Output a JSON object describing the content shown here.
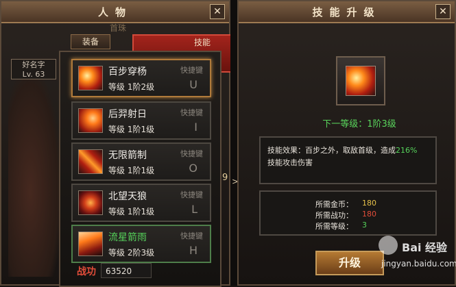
{
  "left_panel": {
    "title": "人物",
    "close_label": "✕",
    "background_label": "首珠",
    "tabs": [
      "装备",
      "技能"
    ],
    "character": {
      "name": "好名字",
      "level": "Lv. 63"
    },
    "skills": [
      {
        "name": "百步穿杨",
        "level_label": "等级",
        "level": "1阶2级",
        "hotkey_label": "快捷键",
        "key": "U",
        "icon": "arrow-burst-icon"
      },
      {
        "name": "后羿射日",
        "level_label": "等级",
        "level": "1阶1级",
        "hotkey_label": "快捷键",
        "key": "I",
        "icon": "sun-arrow-icon"
      },
      {
        "name": "无限箭制",
        "level_label": "等级",
        "level": "1阶1级",
        "hotkey_label": "快捷键",
        "key": "O",
        "icon": "arrow-cross-icon"
      },
      {
        "name": "北望天狼",
        "level_label": "等级",
        "level": "1阶1级",
        "hotkey_label": "快捷键",
        "key": "L",
        "icon": "wolf-spiral-icon"
      },
      {
        "name": "流星箭雨",
        "level_label": "等级",
        "level": "2阶3级",
        "hotkey_label": "快捷键",
        "key": "H",
        "icon": "meteor-arrows-icon"
      }
    ],
    "combat_power_label": "战功",
    "combat_power": "63520",
    "side_number": "9"
  },
  "right_panel": {
    "title": "技能升级",
    "close_label": "✕",
    "next_level": "下一等级：1阶3级",
    "effect_prefix": "技能效果：百步之外，取敌首级，造成",
    "effect_percent": "216%",
    "effect_suffix": "技能攻击伤害",
    "requirements": [
      {
        "label": "所需金币：",
        "value": "180",
        "color": "#e7c24a"
      },
      {
        "label": "所需战功：",
        "value": "180",
        "color": "#e24d3a"
      },
      {
        "label": "所需等级：",
        "value": "3",
        "color": "#56d35b"
      }
    ],
    "upgrade_button": "升级"
  },
  "watermark": {
    "brand": "Bai 经验",
    "url": "jingyan.baidu.com"
  }
}
